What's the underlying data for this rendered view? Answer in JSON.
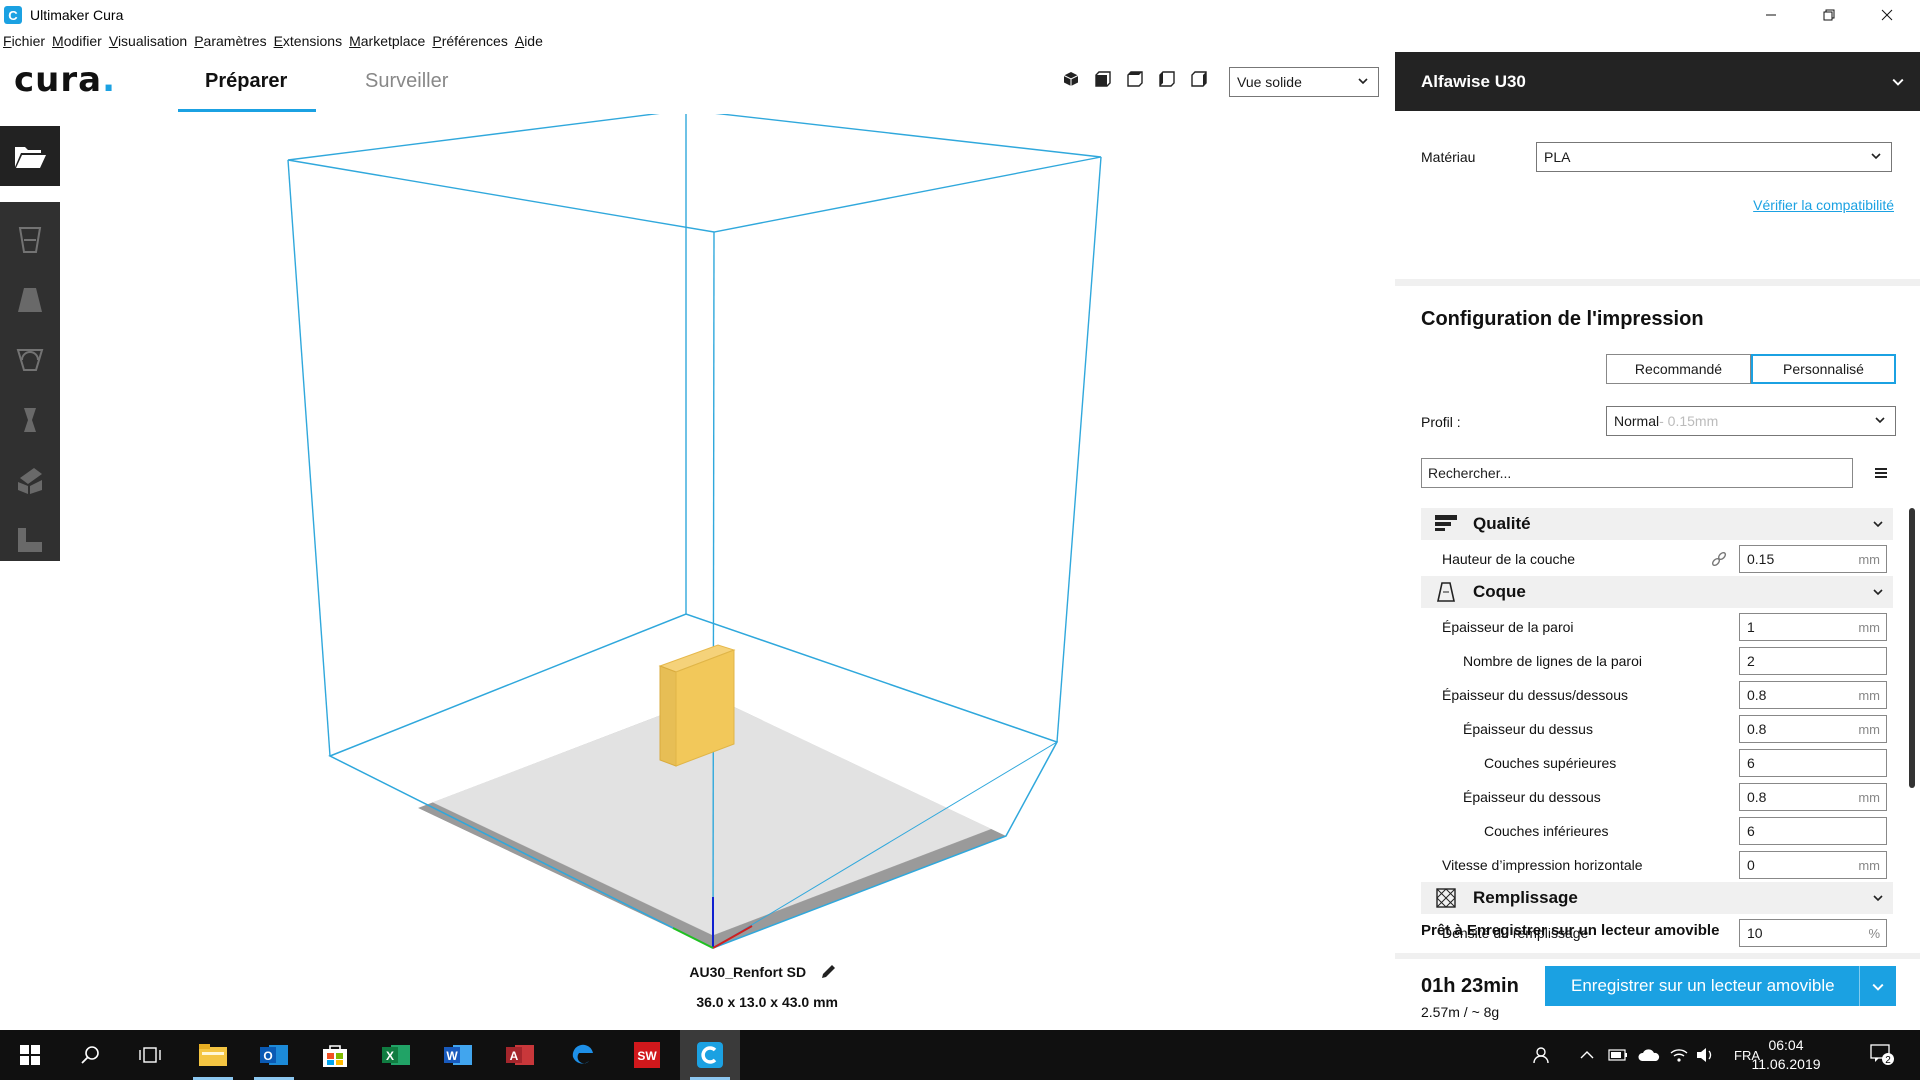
{
  "window": {
    "title": "Ultimaker Cura",
    "app_icon_letter": "C"
  },
  "menubar": [
    "Fichier",
    "Modifier",
    "Visualisation",
    "Paramètres",
    "Extensions",
    "Marketplace",
    "Préférences",
    "Aide"
  ],
  "header": {
    "logo": "cura",
    "logo_dot": ".",
    "tabs": [
      {
        "label": "Préparer",
        "active": true
      },
      {
        "label": "Surveiller",
        "active": false
      }
    ],
    "view_mode": "Vue solide",
    "view_icons": [
      "3d-view-icon",
      "front-view-icon",
      "top-view-icon",
      "left-view-icon",
      "right-view-icon"
    ]
  },
  "viewport": {
    "object_name": "AU30_Renfort SD",
    "object_dimensions": "36.0 x 13.0 x 43.0 mm",
    "build_volume_color": "#30a8dc",
    "object_color": "#f2c85a"
  },
  "left_tools": [
    "move-tool-icon",
    "scale-tool-icon",
    "rotate-tool-icon",
    "mirror-tool-icon",
    "per-model-settings-icon",
    "support-blocker-icon"
  ],
  "panel": {
    "printer": "Alfawise U30",
    "material_label": "Matériau",
    "material_value": "PLA",
    "compat_link": "Vérifier la compatibilité",
    "config_title": "Configuration de l'impression",
    "mode_recommended": "Recommandé",
    "mode_custom": "Personnalisé",
    "profile_label": "Profil :",
    "profile_value": "Normal",
    "profile_detail": " - 0.15mm",
    "search_placeholder": "Rechercher...",
    "categories": {
      "quality": "Qualité",
      "shell": "Coque",
      "infill": "Remplissage"
    },
    "settings": [
      {
        "label": "Hauteur de la couche",
        "value": "0.15",
        "unit": "mm"
      },
      {
        "label": "Épaisseur de la paroi",
        "value": "1",
        "unit": "mm"
      },
      {
        "label": "Nombre de lignes de la paroi",
        "value": "2",
        "unit": ""
      },
      {
        "label": "Épaisseur du dessus/dessous",
        "value": "0.8",
        "unit": "mm"
      },
      {
        "label": "Épaisseur du dessus",
        "value": "0.8",
        "unit": "mm"
      },
      {
        "label": "Couches supérieures",
        "value": "6",
        "unit": ""
      },
      {
        "label": "Épaisseur du dessous",
        "value": "0.8",
        "unit": "mm"
      },
      {
        "label": "Couches inférieures",
        "value": "6",
        "unit": ""
      },
      {
        "label": "Vitesse d’impression horizontale",
        "value": "0",
        "unit": "mm"
      },
      {
        "label": "Densité du remplissage",
        "value": "10",
        "unit": "%"
      }
    ],
    "status": "Prêt à Enregistrer sur un lecteur amovible",
    "print_time": "01h 23min",
    "usage": "2.57m / ~ 8g",
    "save_button": "Enregistrer sur un lecteur amovible"
  },
  "taskbar": {
    "language": "FRA",
    "time": "06:04",
    "date": "11.06.2019",
    "notification_count": "2"
  },
  "colors": {
    "accent": "#1ba1e2",
    "dark": "#232323"
  }
}
